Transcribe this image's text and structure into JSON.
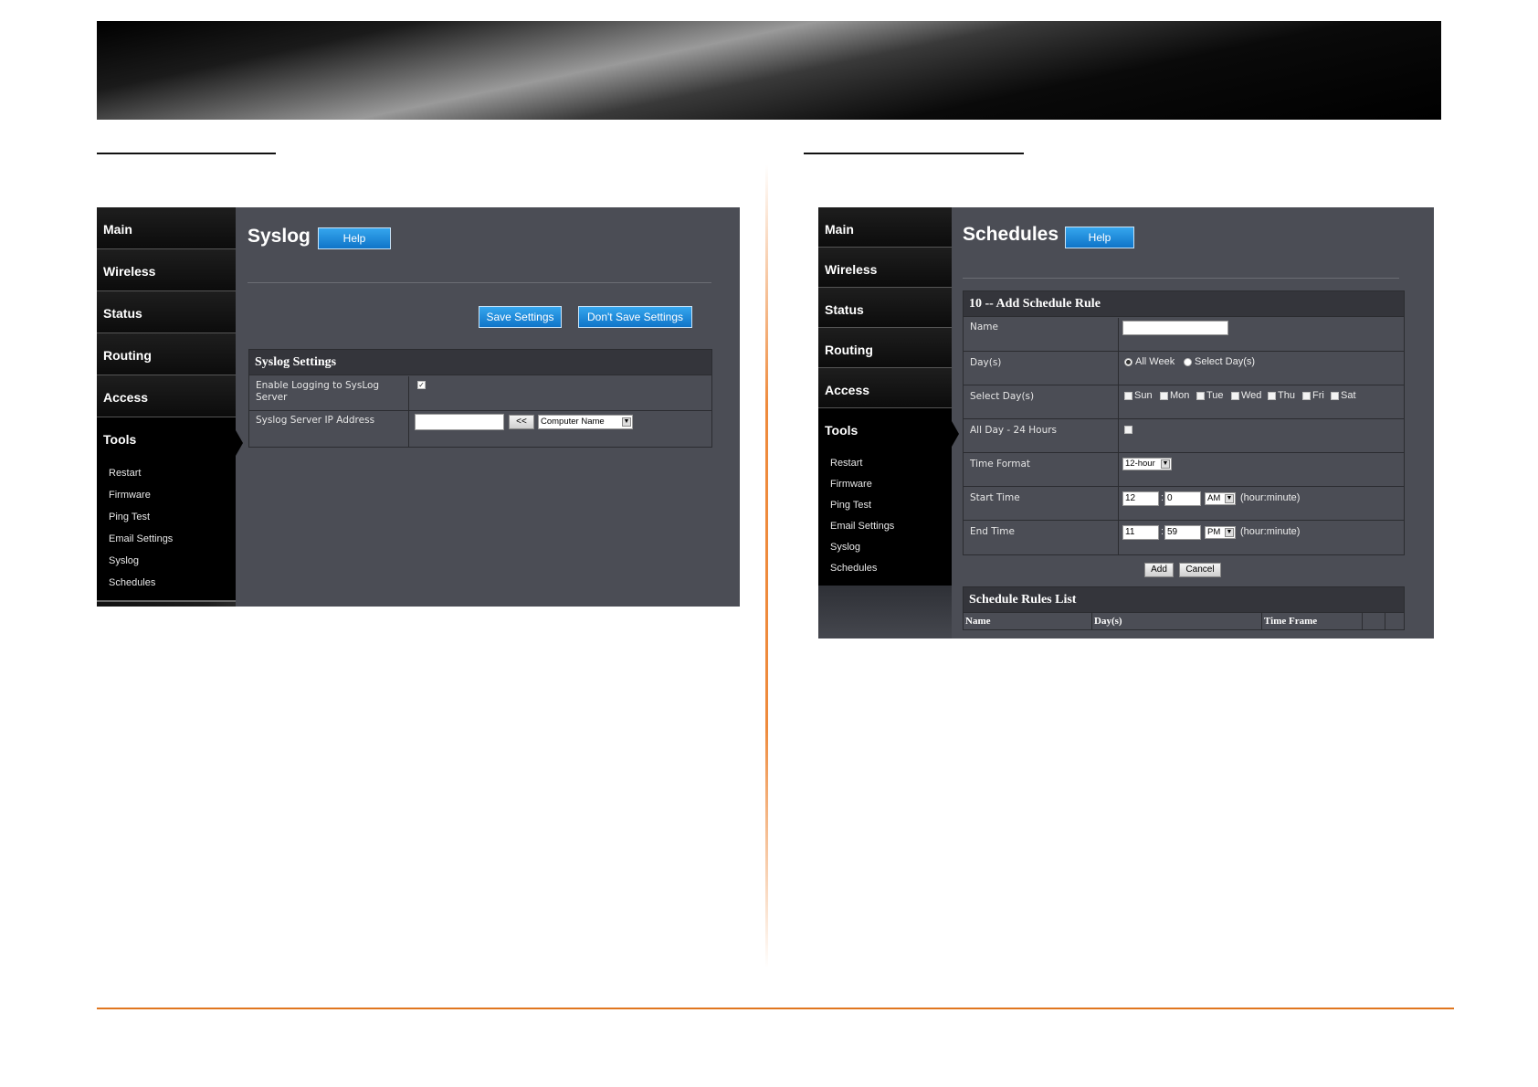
{
  "syslog": {
    "nav": [
      "Main",
      "Wireless",
      "Status",
      "Routing",
      "Access",
      "Tools"
    ],
    "sub": [
      "Restart",
      "Firmware",
      "Ping Test",
      "Email Settings",
      "Syslog",
      "Schedules"
    ],
    "title": "Syslog",
    "help": "Help",
    "save": "Save Settings",
    "dont_save": "Don't Save Settings",
    "panel_title": "Syslog Settings",
    "enable_label": "Enable Logging to SysLog Server",
    "enable_checked": true,
    "ip_label": "Syslog Server IP Address",
    "ip_value": "",
    "arrow_btn": "<<",
    "computer_select": "Computer Name"
  },
  "schedules": {
    "nav": [
      "Main",
      "Wireless",
      "Status",
      "Routing",
      "Access",
      "Tools"
    ],
    "sub": [
      "Restart",
      "Firmware",
      "Ping Test",
      "Email Settings",
      "Syslog",
      "Schedules"
    ],
    "title": "Schedules",
    "help": "Help",
    "panel_title": "10 -- Add Schedule Rule",
    "name_label": "Name",
    "name_value": "",
    "days_label": "Day(s)",
    "all_week": "All Week",
    "select_days": "Select Day(s)",
    "select_days_label": "Select Day(s)",
    "weekdays": [
      "Sun",
      "Mon",
      "Tue",
      "Wed",
      "Thu",
      "Fri",
      "Sat"
    ],
    "allday_label": "All Day - 24 Hours",
    "timefmt_label": "Time Format",
    "timefmt_value": "12-hour",
    "start_label": "Start Time",
    "start_hour": "12",
    "start_min": "0",
    "start_ampm": "AM",
    "end_label": "End Time",
    "end_hour": "11",
    "end_min": "59",
    "end_ampm": "PM",
    "hm_hint": "(hour:minute)",
    "add": "Add",
    "cancel": "Cancel",
    "list_title": "Schedule Rules List",
    "list_cols": [
      "Name",
      "Day(s)",
      "Time Frame"
    ]
  },
  "colors": {
    "accent": "#e0761f",
    "button_blue": "#1f8ada",
    "panel_bg": "#4b4d55"
  }
}
